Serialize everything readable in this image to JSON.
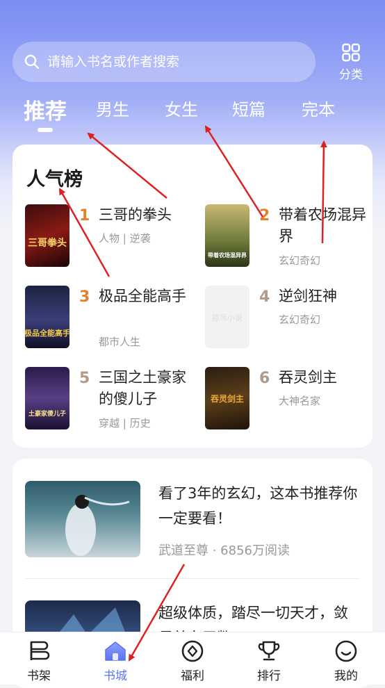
{
  "search": {
    "placeholder": "请输入书名或作者搜索"
  },
  "category": {
    "label": "分类"
  },
  "tabs": [
    {
      "label": "推荐",
      "active": true
    },
    {
      "label": "男生"
    },
    {
      "label": "女生"
    },
    {
      "label": "短篇"
    },
    {
      "label": "完本"
    }
  ],
  "popular": {
    "title": "人气榜",
    "books": [
      {
        "rank": "1",
        "name": "三哥的拳头",
        "tags": "人物 | 逆袭",
        "cover_text": "三哥拳头",
        "rank_color": "#e0822c"
      },
      {
        "rank": "2",
        "name": "带着农场混异界",
        "tags": "玄幻奇幻",
        "cover_text": "带着农场混异界",
        "rank_color": "#e0822c"
      },
      {
        "rank": "3",
        "name": "极品全能高手",
        "tags": "都市人生",
        "cover_text": "极品全能高手",
        "rank_color": "#e0822c"
      },
      {
        "rank": "4",
        "name": "逆剑狂神",
        "tags": "玄幻奇幻",
        "cover_text": "掠风小说",
        "rank_color": "#b09a8a"
      },
      {
        "rank": "5",
        "name": "三国之土豪家的傻儿子",
        "tags": "穿越 | 历史",
        "cover_text": "土豪家傻儿子",
        "rank_color": "#b09a8a"
      },
      {
        "rank": "6",
        "name": "吞灵剑主",
        "tags": "大神名家",
        "cover_text": "吞灵剑主",
        "rank_color": "#b09a8a"
      }
    ]
  },
  "articles": [
    {
      "title": "看了3年的玄幻，这本书推荐你一定要看！",
      "meta": "武道至尊 · 6856万阅读"
    },
    {
      "title": "超级体质，踏尽一切天才，敛尽美女无数！",
      "meta": ""
    }
  ],
  "nav": [
    {
      "label": "书架",
      "icon": "bookshelf-icon"
    },
    {
      "label": "书城",
      "icon": "home-icon",
      "active": true
    },
    {
      "label": "福利",
      "icon": "welfare-icon"
    },
    {
      "label": "排行",
      "icon": "trophy-icon"
    },
    {
      "label": "我的",
      "icon": "smile-icon"
    }
  ],
  "colors": {
    "accent": "#5b74f2",
    "header_start": "#7b8cf4",
    "arrow": "#e02020"
  }
}
